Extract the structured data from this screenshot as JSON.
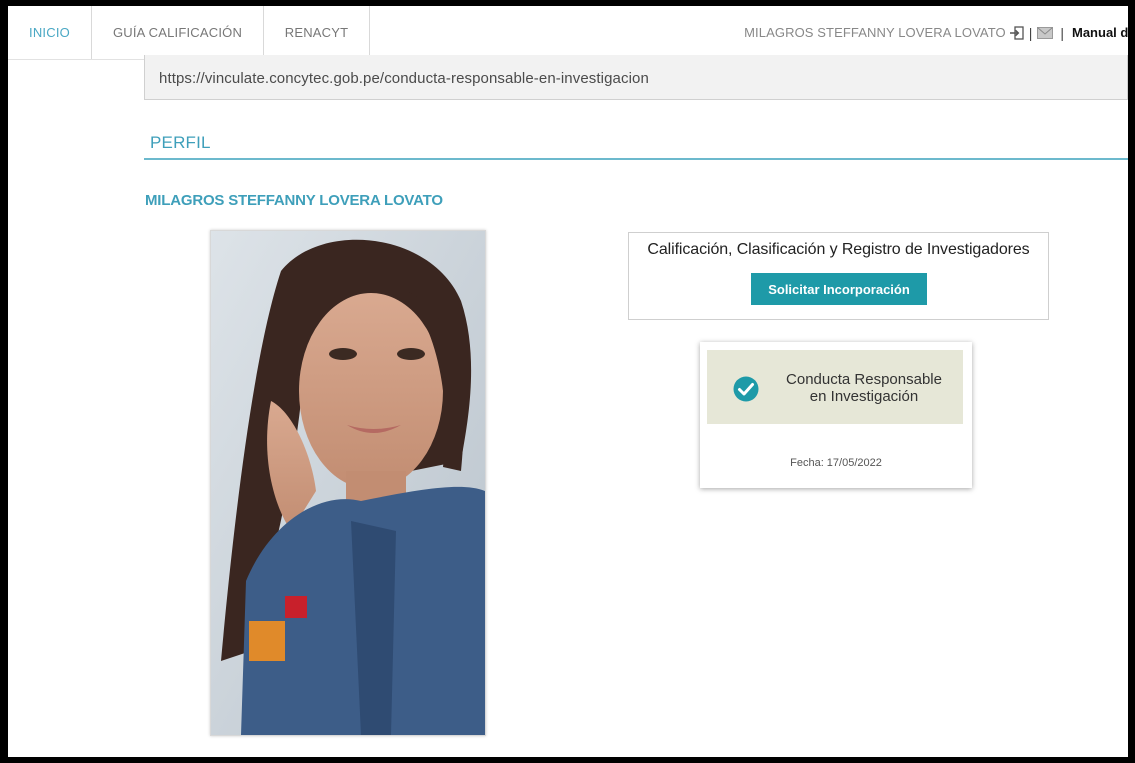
{
  "nav": {
    "tabs": [
      {
        "label": "INICIO",
        "active": true
      },
      {
        "label": "GUÍA CALIFICACIÓN",
        "active": false
      },
      {
        "label": "RENACYT",
        "active": false
      }
    ],
    "user_name": "MILAGROS STEFFANNY LOVERA LOVATO",
    "separator": "|",
    "manual_label": "Manual d",
    "icons": [
      "logout-icon",
      "mail-icon"
    ]
  },
  "url_box": {
    "text": "https://vinculate.concytec.gob.pe/conducta-responsable-en-investigacion"
  },
  "perfil": {
    "section_title": "PERFIL",
    "name": "MILAGROS STEFFANNY LOVERA LOVATO"
  },
  "calificacion": {
    "title": "Calificación, Clasificación y Registro de Investigadores",
    "button_label": "Solicitar Incorporación"
  },
  "conducta": {
    "line1": "Conducta Responsable",
    "line2": "en Investigación",
    "fecha": "Fecha: 17/05/2022",
    "icon": "check-circle-icon"
  },
  "colors": {
    "accent": "#3e9fba",
    "button": "#1e9aa8",
    "badge_bg": "#e6e7d7",
    "check": "#1e9aa8"
  }
}
